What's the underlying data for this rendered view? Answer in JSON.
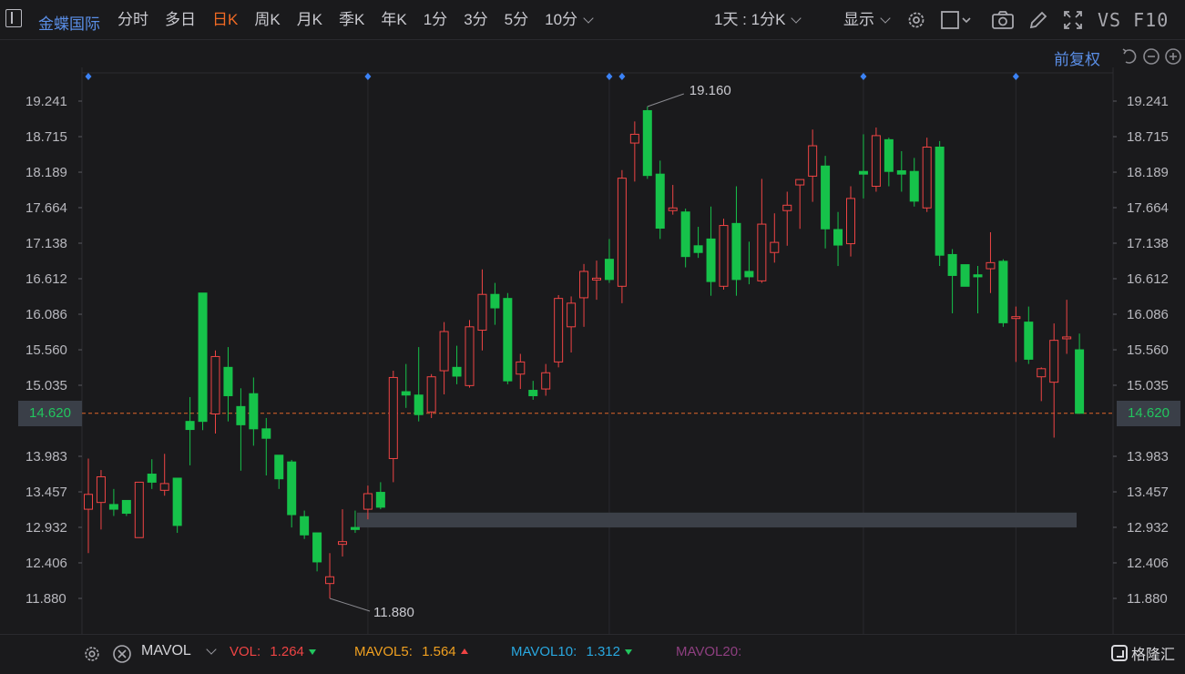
{
  "header": {
    "stock_name": "金蝶国际",
    "tabs": [
      {
        "label": "分时"
      },
      {
        "label": "多日"
      },
      {
        "label": "日K",
        "active": true
      },
      {
        "label": "周K"
      },
      {
        "label": "月K"
      },
      {
        "label": "季K"
      },
      {
        "label": "年K"
      },
      {
        "label": "1分"
      },
      {
        "label": "3分"
      },
      {
        "label": "5分"
      },
      {
        "label": "10分"
      }
    ],
    "period_label": "1天 : 1分K",
    "display_label": "显示",
    "vs_label": "VS F10"
  },
  "subheader": {
    "adjust_label": "前复权"
  },
  "chart_data": {
    "type": "candlestick",
    "y_ticks": [
      "19.241",
      "18.715",
      "18.189",
      "17.664",
      "17.138",
      "16.612",
      "16.086",
      "15.560",
      "15.035",
      "14.620",
      "13.983",
      "13.457",
      "12.932",
      "12.406",
      "11.880"
    ],
    "current_price": "14.620",
    "high_label": "19.160",
    "low_label": "11.880",
    "ylim": [
      11.6,
      19.6
    ],
    "colors": {
      "up": "#ef4444",
      "down": "#16c24a",
      "price_line": "#e0662a",
      "band": "#3c4048"
    },
    "band": {
      "from": 12.93,
      "to": 13.15,
      "start_index": 21
    },
    "markers_at": [
      0,
      22,
      41,
      42,
      61,
      73
    ],
    "candles": [
      {
        "o": 13.2,
        "h": 13.95,
        "l": 12.55,
        "c": 13.42
      },
      {
        "o": 13.3,
        "h": 13.78,
        "l": 12.9,
        "c": 13.68
      },
      {
        "o": 13.27,
        "h": 13.5,
        "l": 13.1,
        "c": 13.2
      },
      {
        "o": 13.33,
        "h": 13.33,
        "l": 13.1,
        "c": 13.14
      },
      {
        "o": 12.78,
        "h": 13.55,
        "l": 12.78,
        "c": 13.6
      },
      {
        "o": 13.72,
        "h": 13.94,
        "l": 13.5,
        "c": 13.6
      },
      {
        "o": 13.48,
        "h": 14.02,
        "l": 13.4,
        "c": 13.58
      },
      {
        "o": 13.66,
        "h": 13.66,
        "l": 12.85,
        "c": 12.96
      },
      {
        "o": 14.5,
        "h": 14.86,
        "l": 13.85,
        "c": 14.38
      },
      {
        "o": 16.4,
        "h": 16.4,
        "l": 14.37,
        "c": 14.5
      },
      {
        "o": 14.61,
        "h": 15.55,
        "l": 14.32,
        "c": 15.46
      },
      {
        "o": 15.3,
        "h": 15.6,
        "l": 14.5,
        "c": 14.88
      },
      {
        "o": 14.72,
        "h": 14.99,
        "l": 13.77,
        "c": 14.45
      },
      {
        "o": 14.91,
        "h": 15.15,
        "l": 14.14,
        "c": 14.39
      },
      {
        "o": 14.39,
        "h": 14.55,
        "l": 13.7,
        "c": 14.25
      },
      {
        "o": 14.0,
        "h": 14.0,
        "l": 13.5,
        "c": 13.65
      },
      {
        "o": 13.9,
        "h": 13.93,
        "l": 12.93,
        "c": 13.12
      },
      {
        "o": 13.09,
        "h": 13.18,
        "l": 12.76,
        "c": 12.82
      },
      {
        "o": 12.85,
        "h": 12.85,
        "l": 12.28,
        "c": 12.42
      },
      {
        "o": 12.1,
        "h": 12.55,
        "l": 11.88,
        "c": 12.2
      },
      {
        "o": 12.68,
        "h": 13.2,
        "l": 12.5,
        "c": 12.72
      },
      {
        "o": 12.93,
        "h": 13.18,
        "l": 12.85,
        "c": 12.9
      },
      {
        "o": 13.2,
        "h": 13.55,
        "l": 13.05,
        "c": 13.43
      },
      {
        "o": 13.45,
        "h": 13.6,
        "l": 13.2,
        "c": 13.23
      },
      {
        "o": 13.95,
        "h": 15.25,
        "l": 13.6,
        "c": 15.15
      },
      {
        "o": 14.94,
        "h": 15.35,
        "l": 14.7,
        "c": 14.89
      },
      {
        "o": 14.89,
        "h": 15.6,
        "l": 14.5,
        "c": 14.6
      },
      {
        "o": 14.64,
        "h": 15.2,
        "l": 14.55,
        "c": 15.16
      },
      {
        "o": 15.25,
        "h": 15.97,
        "l": 14.9,
        "c": 15.83
      },
      {
        "o": 15.3,
        "h": 15.62,
        "l": 15.05,
        "c": 15.17
      },
      {
        "o": 15.03,
        "h": 16.0,
        "l": 15.0,
        "c": 15.9
      },
      {
        "o": 15.85,
        "h": 16.75,
        "l": 15.55,
        "c": 16.38
      },
      {
        "o": 16.38,
        "h": 16.55,
        "l": 15.93,
        "c": 16.18
      },
      {
        "o": 16.32,
        "h": 16.4,
        "l": 15.05,
        "c": 15.1
      },
      {
        "o": 15.2,
        "h": 15.5,
        "l": 14.98,
        "c": 15.38
      },
      {
        "o": 14.96,
        "h": 15.1,
        "l": 14.82,
        "c": 14.88
      },
      {
        "o": 14.98,
        "h": 15.35,
        "l": 14.88,
        "c": 15.22
      },
      {
        "o": 15.38,
        "h": 16.37,
        "l": 15.3,
        "c": 16.32
      },
      {
        "o": 15.9,
        "h": 16.35,
        "l": 15.52,
        "c": 16.25
      },
      {
        "o": 16.33,
        "h": 16.83,
        "l": 15.9,
        "c": 16.72
      },
      {
        "o": 16.62,
        "h": 16.88,
        "l": 16.3,
        "c": 16.62
      },
      {
        "o": 16.9,
        "h": 17.2,
        "l": 16.55,
        "c": 16.6
      },
      {
        "o": 16.5,
        "h": 18.22,
        "l": 16.25,
        "c": 18.1
      },
      {
        "o": 18.62,
        "h": 18.94,
        "l": 18.05,
        "c": 18.75
      },
      {
        "o": 19.1,
        "h": 19.16,
        "l": 18.09,
        "c": 18.14
      },
      {
        "o": 18.16,
        "h": 18.36,
        "l": 17.2,
        "c": 17.36
      },
      {
        "o": 17.62,
        "h": 18.0,
        "l": 17.56,
        "c": 17.66
      },
      {
        "o": 17.6,
        "h": 17.65,
        "l": 16.78,
        "c": 16.94
      },
      {
        "o": 17.1,
        "h": 17.38,
        "l": 16.92,
        "c": 17.0
      },
      {
        "o": 17.2,
        "h": 17.68,
        "l": 16.36,
        "c": 16.57
      },
      {
        "o": 16.5,
        "h": 17.5,
        "l": 16.45,
        "c": 17.4
      },
      {
        "o": 17.43,
        "h": 17.98,
        "l": 16.36,
        "c": 16.6
      },
      {
        "o": 16.72,
        "h": 17.16,
        "l": 16.53,
        "c": 16.64
      },
      {
        "o": 16.58,
        "h": 18.09,
        "l": 16.55,
        "c": 17.42
      },
      {
        "o": 17.0,
        "h": 17.58,
        "l": 16.85,
        "c": 17.15
      },
      {
        "o": 17.62,
        "h": 17.9,
        "l": 17.1,
        "c": 17.7
      },
      {
        "o": 18.0,
        "h": 18.0,
        "l": 17.35,
        "c": 18.08
      },
      {
        "o": 18.13,
        "h": 18.82,
        "l": 17.75,
        "c": 18.58
      },
      {
        "o": 18.28,
        "h": 18.43,
        "l": 17.06,
        "c": 17.35
      },
      {
        "o": 17.34,
        "h": 17.6,
        "l": 16.8,
        "c": 17.11
      },
      {
        "o": 17.13,
        "h": 17.98,
        "l": 16.94,
        "c": 17.8
      },
      {
        "o": 18.2,
        "h": 18.75,
        "l": 17.8,
        "c": 18.16
      },
      {
        "o": 17.98,
        "h": 18.85,
        "l": 17.9,
        "c": 18.73
      },
      {
        "o": 18.67,
        "h": 18.7,
        "l": 17.98,
        "c": 18.2
      },
      {
        "o": 18.21,
        "h": 18.5,
        "l": 17.9,
        "c": 18.16
      },
      {
        "o": 18.2,
        "h": 18.4,
        "l": 17.68,
        "c": 17.76
      },
      {
        "o": 17.66,
        "h": 18.7,
        "l": 17.6,
        "c": 18.56
      },
      {
        "o": 18.56,
        "h": 18.65,
        "l": 16.8,
        "c": 16.96
      },
      {
        "o": 16.97,
        "h": 17.05,
        "l": 16.1,
        "c": 16.66
      },
      {
        "o": 16.82,
        "h": 16.82,
        "l": 16.5,
        "c": 16.5
      },
      {
        "o": 16.67,
        "h": 16.8,
        "l": 16.1,
        "c": 16.64
      },
      {
        "o": 16.76,
        "h": 17.3,
        "l": 16.4,
        "c": 16.85
      },
      {
        "o": 16.87,
        "h": 16.9,
        "l": 15.9,
        "c": 15.96
      },
      {
        "o": 16.03,
        "h": 16.2,
        "l": 15.38,
        "c": 16.05
      },
      {
        "o": 15.97,
        "h": 16.2,
        "l": 15.35,
        "c": 15.42
      },
      {
        "o": 15.16,
        "h": 15.3,
        "l": 14.8,
        "c": 15.28
      },
      {
        "o": 15.08,
        "h": 15.95,
        "l": 14.26,
        "c": 15.7
      },
      {
        "o": 15.73,
        "h": 16.3,
        "l": 15.5,
        "c": 15.75
      },
      {
        "o": 15.56,
        "h": 15.8,
        "l": 14.62,
        "c": 14.62
      }
    ]
  },
  "bottom": {
    "indicator_name": "MAVOL",
    "vol_label": "VOL:",
    "vol_value": "1.264",
    "mavol5_label": "MAVOL5:",
    "mavol5_value": "1.564",
    "mavol10_label": "MAVOL10:",
    "mavol10_value": "1.312",
    "mavol20_label": "MAVOL20:",
    "logo_text": "格隆汇"
  }
}
